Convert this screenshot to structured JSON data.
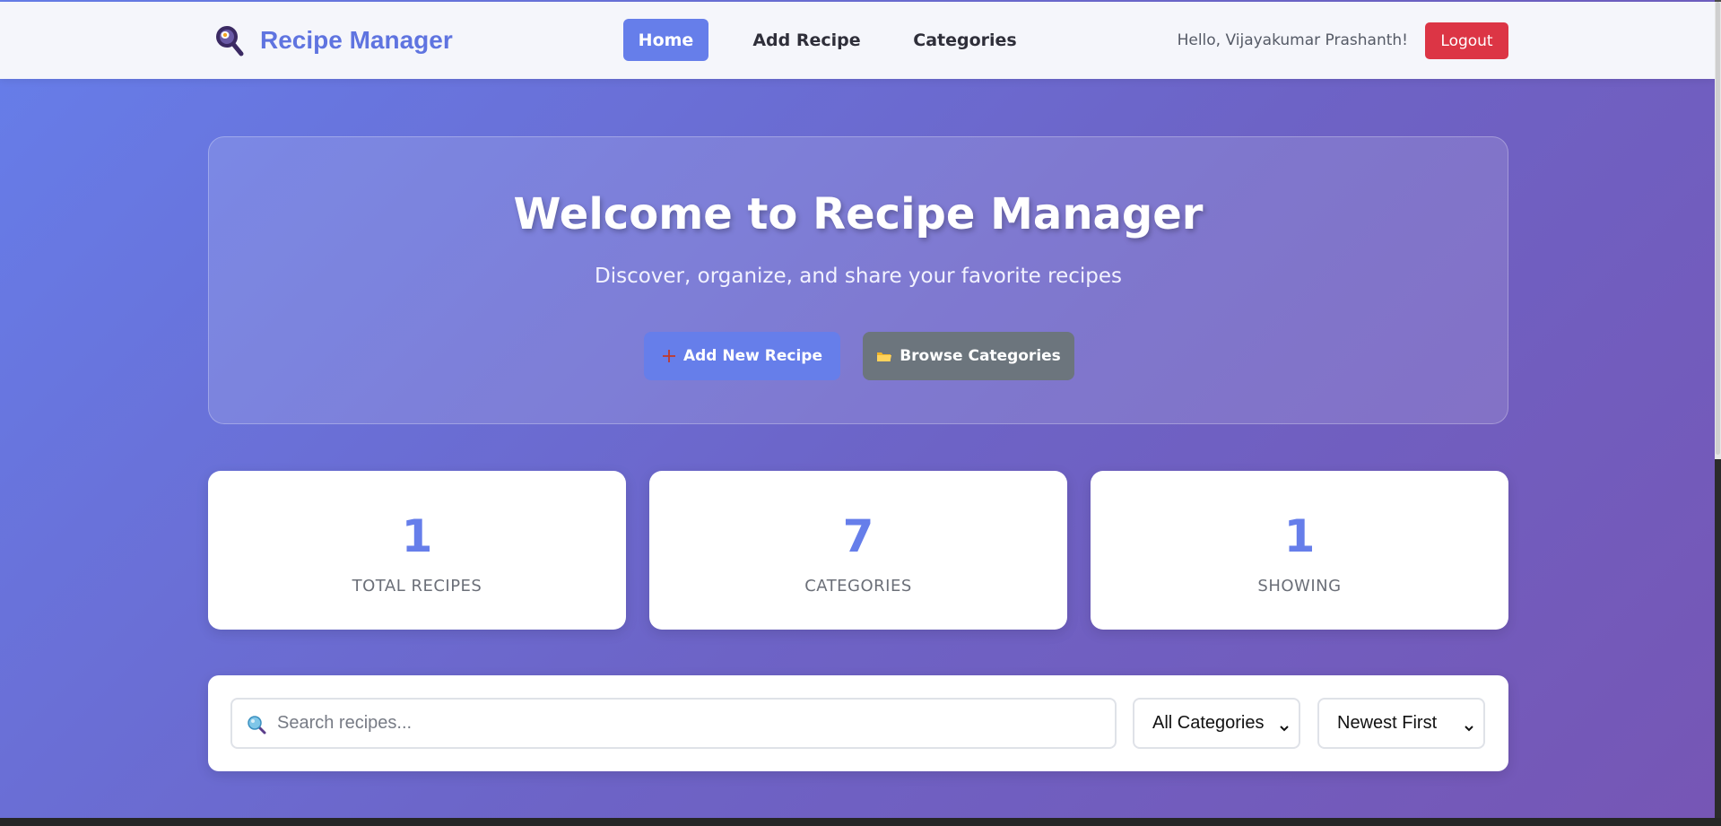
{
  "navbar": {
    "brand": "Recipe Manager",
    "brand_icon": "magnifier-pan-icon",
    "links": [
      {
        "label": "Home",
        "active": true
      },
      {
        "label": "Add Recipe",
        "active": false
      },
      {
        "label": "Categories",
        "active": false
      }
    ],
    "greeting": "Hello, Vijayakumar Prashanth!",
    "logout_label": "Logout"
  },
  "hero": {
    "title": "Welcome to Recipe Manager",
    "subtitle": "Discover, organize, and share your favorite recipes",
    "add_button": "Add New Recipe",
    "add_icon": "plus-icon",
    "browse_button": "Browse Categories",
    "browse_icon": "folder-icon"
  },
  "stats": [
    {
      "value": "1",
      "label": "TOTAL RECIPES"
    },
    {
      "value": "7",
      "label": "CATEGORIES"
    },
    {
      "value": "1",
      "label": "SHOWING"
    }
  ],
  "search": {
    "placeholder": "Search recipes...",
    "value": "",
    "category_selected": "All Categories",
    "sort_selected": "Newest First"
  },
  "colors": {
    "accent": "#667eea",
    "danger": "#dc3545",
    "secondary": "#6c757d",
    "gradient_start": "#667eea",
    "gradient_end": "#764ba2"
  }
}
